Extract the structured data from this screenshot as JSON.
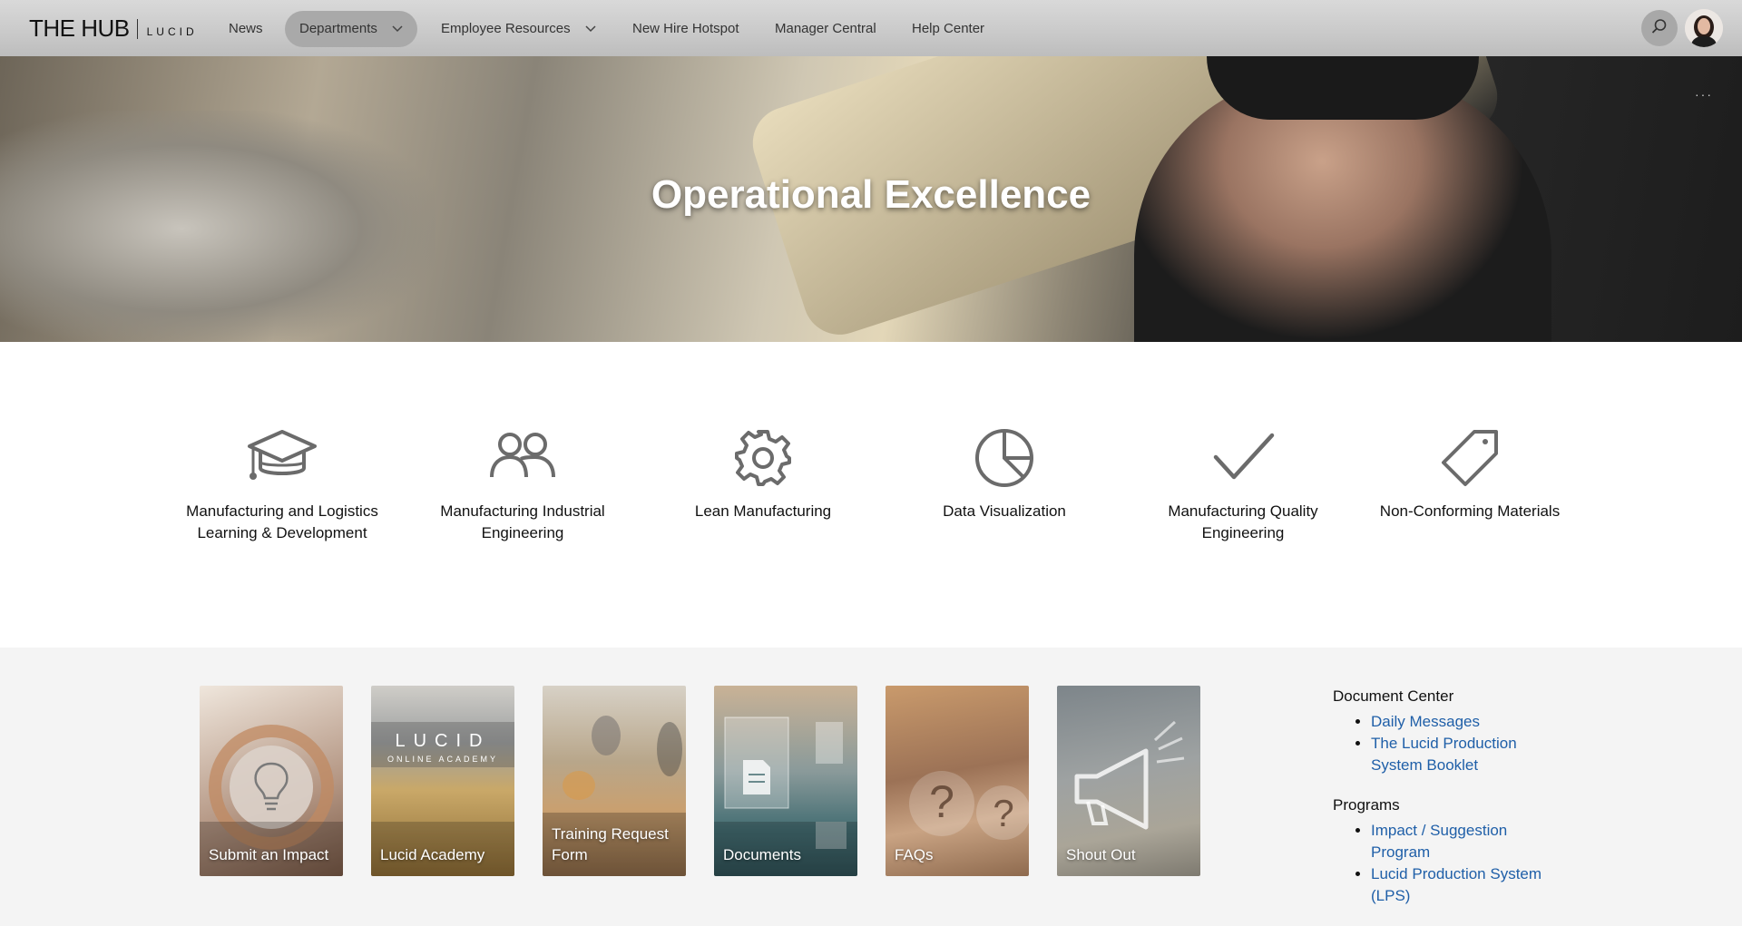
{
  "nav": {
    "logo": {
      "main": "THE HUB",
      "brand": "LUCID"
    },
    "items": [
      {
        "label": "News"
      },
      {
        "label": "Departments"
      },
      {
        "label": "Employee Resources"
      },
      {
        "label": "New Hire Hotspot"
      },
      {
        "label": "Manager Central"
      },
      {
        "label": "Help Center"
      }
    ],
    "search_icon": "search-icon",
    "avatar_icon": "user-avatar"
  },
  "hero": {
    "title": "Operational Excellence",
    "more": "···"
  },
  "departments": [
    {
      "icon": "graduation-cap-icon",
      "label": "Manufacturing and Logistics Learning & Development"
    },
    {
      "icon": "people-icon",
      "label": "Manufacturing Industrial Engineering"
    },
    {
      "icon": "gear-icon",
      "label": "Lean Manufacturing"
    },
    {
      "icon": "pie-chart-icon",
      "label": "Data Visualization"
    },
    {
      "icon": "checkmark-icon",
      "label": "Manufacturing Quality Engineering"
    },
    {
      "icon": "tag-icon",
      "label": "Non-Conforming Materials"
    }
  ],
  "tiles": [
    {
      "label": "Submit an Impact",
      "icon": "lightbulb-icon"
    },
    {
      "label": "Lucid Academy",
      "icon": "lucid-online-academy-logo",
      "logo_text": "LUCID",
      "logo_sub": "ONLINE ACADEMY"
    },
    {
      "label": "Training Request Form"
    },
    {
      "label": "Documents",
      "icon": "documents-icon"
    },
    {
      "label": "FAQs",
      "icon": "question-mark-icon"
    },
    {
      "label": "Shout Out",
      "icon": "megaphone-icon"
    }
  ],
  "sidebar": {
    "document_center": {
      "heading": "Document Center",
      "links": [
        "Daily Messages",
        "The Lucid Production System Booklet"
      ]
    },
    "programs": {
      "heading": "Programs",
      "links": [
        "Impact / Suggestion Program",
        "Lucid Production System (LPS)"
      ]
    }
  },
  "colors": {
    "nav_bg": "#c9c9c9",
    "nav_active": "#a9a9a9",
    "icon_gray": "#6b6b6b",
    "link_blue": "#1f5fa8",
    "lower_bg": "#f4f4f4"
  }
}
